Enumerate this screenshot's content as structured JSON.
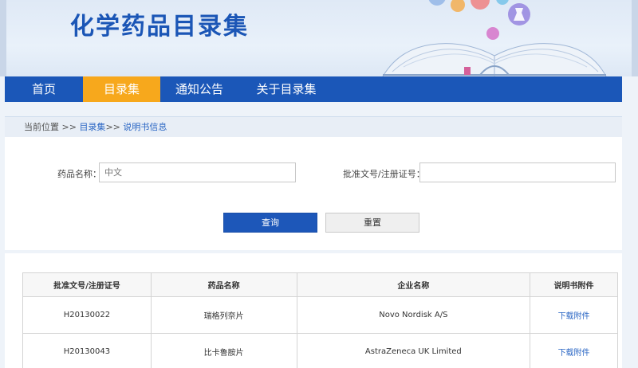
{
  "site": {
    "title": "化学药品目录集"
  },
  "nav": {
    "items": [
      {
        "label": "首页"
      },
      {
        "label": "目录集"
      },
      {
        "label": "通知公告"
      },
      {
        "label": "关于目录集"
      }
    ],
    "active_index": 1,
    "colors": {
      "bar": "#1b57b8",
      "active": "#f7a81c"
    }
  },
  "breadcrumb": {
    "prefix": "当前位置 >> ",
    "level1": "目录集",
    "separator": ">> ",
    "level2": "说明书信息"
  },
  "search": {
    "drug_name_label": "药品名称：",
    "drug_name_placeholder": "中文",
    "drug_name_value": "",
    "approval_label": "批准文号/注册证号：",
    "approval_placeholder": "",
    "approval_value": "",
    "query_button": "查询",
    "reset_button": "重置"
  },
  "results": {
    "columns": [
      "批准文号/注册证号",
      "药品名称",
      "企业名称",
      "说明书附件"
    ],
    "rows": [
      {
        "approval_no": "H20130022",
        "drug_name": "瑞格列奈片",
        "company": "Novo Nordisk A/S",
        "attachment": "下载附件"
      },
      {
        "approval_no": "H20130043",
        "drug_name": "比卡鲁胺片",
        "company": "AstraZeneca UK Limited",
        "attachment": "下载附件"
      }
    ]
  }
}
